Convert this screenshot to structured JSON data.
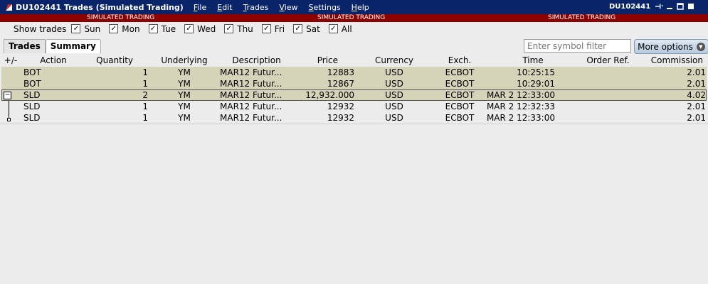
{
  "window": {
    "title": "DU102441 Trades (Simulated Trading)",
    "account": "DU102441",
    "menu": [
      "File",
      "Edit",
      "Trades",
      "View",
      "Settings",
      "Help"
    ]
  },
  "sim_banner": "SIMULATED TRADING",
  "filters": {
    "label": "Show trades",
    "days": [
      {
        "label": "Sun",
        "checked": true
      },
      {
        "label": "Mon",
        "checked": true
      },
      {
        "label": "Tue",
        "checked": true
      },
      {
        "label": "Wed",
        "checked": true
      },
      {
        "label": "Thu",
        "checked": true
      },
      {
        "label": "Fri",
        "checked": true
      },
      {
        "label": "Sat",
        "checked": true
      },
      {
        "label": "All",
        "checked": true
      }
    ]
  },
  "tabs": [
    {
      "label": "Trades",
      "active": false
    },
    {
      "label": "Summary",
      "active": true
    }
  ],
  "symbol_filter": {
    "placeholder": "Enter symbol filter",
    "value": ""
  },
  "more_options_label": "More options",
  "table": {
    "columns": [
      "+/-",
      "Action",
      "Quantity",
      "Underlying",
      "Description",
      "Price",
      "Currency",
      "Exch.",
      "Time",
      "Order Ref.",
      "Commission"
    ],
    "rows": [
      {
        "toggle": "",
        "action": "BOT",
        "quantity": "1",
        "underlying": "YM",
        "description": "MAR12 Futur...",
        "price": "12883",
        "currency": "USD",
        "exch": "ECBOT",
        "time": "10:25:15",
        "order_ref": "",
        "commission": "2.01"
      },
      {
        "toggle": "",
        "action": "BOT",
        "quantity": "1",
        "underlying": "YM",
        "description": "MAR12 Futur...",
        "price": "12867",
        "currency": "USD",
        "exch": "ECBOT",
        "time": "10:29:01",
        "order_ref": "",
        "commission": "2.01"
      },
      {
        "toggle": "−",
        "action": "SLD",
        "quantity": "2",
        "underlying": "YM",
        "description": "MAR12 Futur...",
        "price": "12,932.000",
        "currency": "USD",
        "exch": "ECBOT",
        "time": "MAR 2 12:33:00",
        "order_ref": "",
        "commission": "4.02"
      },
      {
        "toggle": "",
        "action": "SLD",
        "quantity": "1",
        "underlying": "YM",
        "description": "MAR12 Futur...",
        "price": "12932",
        "currency": "USD",
        "exch": "ECBOT",
        "time": "MAR 2 12:32:33",
        "order_ref": "",
        "commission": "2.01"
      },
      {
        "toggle": "",
        "action": "SLD",
        "quantity": "1",
        "underlying": "YM",
        "description": "MAR12 Futur...",
        "price": "12932",
        "currency": "USD",
        "exch": "ECBOT",
        "time": "MAR 2 12:33:00",
        "order_ref": "",
        "commission": "2.01"
      }
    ]
  },
  "colors": {
    "title_bar": "#0a246a",
    "sim_banner": "#8c0000",
    "row_highlight": "#d5d3b8",
    "background": "#ececec"
  }
}
